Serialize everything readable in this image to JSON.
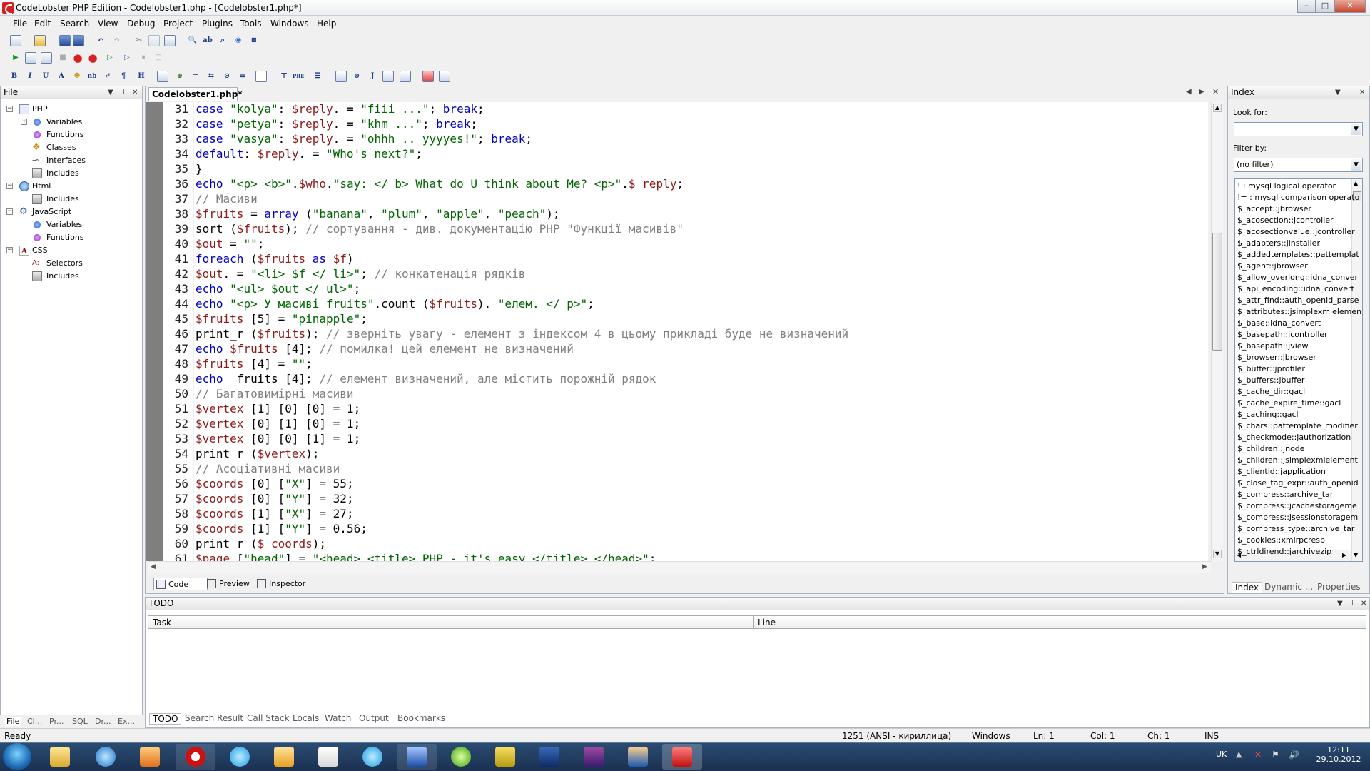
{
  "window": {
    "title": "CodeLobster PHP Edition - Codelobster1.php - [Codelobster1.php*]",
    "buttons": [
      "–",
      "□",
      "✕"
    ]
  },
  "menu": [
    "File",
    "Edit",
    "Search",
    "View",
    "Debug",
    "Project",
    "Plugins",
    "Tools",
    "Windows",
    "Help"
  ],
  "file_panel": {
    "title": "File",
    "tree": [
      {
        "label": "PHP",
        "level": 0,
        "expanded": true
      },
      {
        "label": "Variables",
        "level": 1,
        "expandable": true
      },
      {
        "label": "Functions",
        "level": 1
      },
      {
        "label": "Classes",
        "level": 1
      },
      {
        "label": "Interfaces",
        "level": 1
      },
      {
        "label": "Includes",
        "level": 1
      },
      {
        "label": "Html",
        "level": 0,
        "expanded": true
      },
      {
        "label": "Includes",
        "level": 1
      },
      {
        "label": "JavaScript",
        "level": 0,
        "expanded": true
      },
      {
        "label": "Variables",
        "level": 1
      },
      {
        "label": "Functions",
        "level": 1
      },
      {
        "label": "CSS",
        "level": 0,
        "expanded": true
      },
      {
        "label": "Selectors",
        "level": 1
      },
      {
        "label": "Includes",
        "level": 1
      }
    ],
    "tabs": [
      "File",
      "Cl...",
      "Pr...",
      "SQL",
      "Dr...",
      "Ex..."
    ]
  },
  "editor": {
    "tab": "Codelobster1.php*",
    "lines": [
      {
        "n": "31",
        "t": "case \"kolya\": $reply. = \"fiii ...\"; break;"
      },
      {
        "n": "32",
        "t": "case \"petya\": $reply. = \"khm ...\"; break;"
      },
      {
        "n": "33",
        "t": "case \"vasya\": $reply. = \"ohhh .. yyyyes!\"; break;"
      },
      {
        "n": "34",
        "t": "default: $reply. = \"Who's next?\";"
      },
      {
        "n": "35",
        "t": "}"
      },
      {
        "n": "36",
        "t": "echo \"<p> <b>\".$who.\"say: </ b> What do U think about Me? <p>\".$ reply;"
      },
      {
        "n": "37",
        "t": "// Масиви"
      },
      {
        "n": "38",
        "t": "$fruits = array (\"banana\", \"plum\", \"apple\", \"peach\");"
      },
      {
        "n": "39",
        "t": "sort ($fruits); // сортування - див. документацію PHP \"Функції масивів\""
      },
      {
        "n": "40",
        "t": "$out = \"\";"
      },
      {
        "n": "41",
        "t": "foreach ($fruits as $f)"
      },
      {
        "n": "42",
        "t": "$out. = \"<li> $f </ li>\"; // конкатенація рядків"
      },
      {
        "n": "43",
        "t": "echo \"<ul> $out </ ul>\";"
      },
      {
        "n": "44",
        "t": "echo \"<p> У масиві fruits\".count ($fruits). \"елем. </ p>\";"
      },
      {
        "n": "45",
        "t": "$fruits [5] = \"pinapple\";"
      },
      {
        "n": "46",
        "t": "print_r ($fruits); // зверніть увагу - елемент з індексом 4 в цьому прикладі буде не визначений"
      },
      {
        "n": "47",
        "t": "echo $fruits [4]; // помилка! цей елемент не визначений"
      },
      {
        "n": "48",
        "t": "$fruits [4] = \"\";"
      },
      {
        "n": "49",
        "t": "echo  fruits [4]; // елемент визначений, але містить порожній рядок"
      },
      {
        "n": "50",
        "t": "// Багатовимірні масиви"
      },
      {
        "n": "51",
        "t": "$vertex [1] [0] [0] = 1;"
      },
      {
        "n": "52",
        "t": "$vertex [0] [1] [0] = 1;"
      },
      {
        "n": "53",
        "t": "$vertex [0] [0] [1] = 1;"
      },
      {
        "n": "54",
        "t": "print_r ($vertex);"
      },
      {
        "n": "55",
        "t": "// Асоціативні масиви"
      },
      {
        "n": "56",
        "t": "$coords [0] [\"X\"] = 55;"
      },
      {
        "n": "57",
        "t": "$coords [0] [\"Y\"] = 32;"
      },
      {
        "n": "58",
        "t": "$coords [1] [\"X\"] = 27;"
      },
      {
        "n": "59",
        "t": "$coords [1] [\"Y\"] = 0.56;"
      },
      {
        "n": "60",
        "t": "print_r ($ coords);"
      },
      {
        "n": "61",
        "t": "$page [\"head\"] = \"<head> <title> PHP - it's easy </title> </head>\";"
      }
    ],
    "view_tabs": [
      "Code",
      "Preview",
      "Inspector"
    ]
  },
  "index_panel": {
    "title": "Index",
    "look_for_label": "Look for:",
    "look_for_value": "",
    "filter_label": "Filter by:",
    "filter_value": "(no filter)",
    "items": [
      "! : mysql logical operator",
      "!= : mysql comparison operato",
      "$_accept::jbrowser",
      "$_acosection::jcontroller",
      "$_acosectionvalue::jcontroller",
      "$_adapters::jinstaller",
      "$_addedtemplates::pattemplat",
      "$_agent::jbrowser",
      "$_allow_overlong::idna_conver",
      "$_api_encoding::idna_convert",
      "$_attr_find::auth_openid_parse",
      "$_attributes::jsimplexmlelemen",
      "$_base::idna_convert",
      "$_basepath::jcontroller",
      "$_basepath::jview",
      "$_browser::jbrowser",
      "$_buffer::jprofiler",
      "$_buffers::jbuffer",
      "$_cache_dir::gacl",
      "$_cache_expire_time::gacl",
      "$_caching::gacl",
      "$_chars::pattemplate_modifier",
      "$_checkmode::jauthorization",
      "$_children::jnode",
      "$_children::jsimplexmlelement",
      "$_clientid::japplication",
      "$_close_tag_expr::auth_openid",
      "$_compress::archive_tar",
      "$_compress::jcachestorageme",
      "$_compress::jsessionstoragem",
      "$_compress_type::archive_tar",
      "$_cookies::xmlrpcresp",
      "$_ctrldirend::jarchivezip"
    ],
    "tabs": [
      "Index",
      "Dynamic ...",
      "Properties"
    ]
  },
  "todo_panel": {
    "title": "TODO",
    "columns": [
      "Task",
      "Line"
    ],
    "tabs": [
      "TODO",
      "Search Result",
      "Call Stack",
      "Locals",
      "Watch",
      "Output",
      "Bookmarks"
    ]
  },
  "status": {
    "left": "Ready",
    "encoding": "1251 (ANSI - кириллица)",
    "eol": "Windows",
    "ln": "Ln: 1",
    "col": "Col: 1",
    "ch": "Ch: 1",
    "mode": "INS"
  },
  "taskbar": {
    "lang": "UK",
    "time": "12:11",
    "date": "29.10.2012"
  }
}
